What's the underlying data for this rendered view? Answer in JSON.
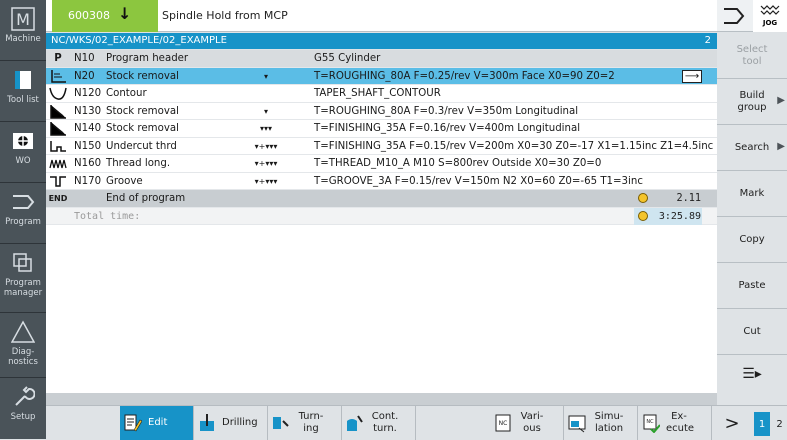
{
  "sidebar": [
    {
      "label": "Machine",
      "icon": "m-letter-icon"
    },
    {
      "label": "Tool list",
      "icon": "tool-list-icon"
    },
    {
      "label": "WO",
      "icon": "wear-offset-icon"
    },
    {
      "label": "Program",
      "icon": "program-icon"
    },
    {
      "label": "Program manager",
      "icon": "program-manager-icon"
    },
    {
      "label": "Diag-nostics",
      "icon": "diagnostics-icon"
    },
    {
      "label": "Setup",
      "icon": "wrench-icon"
    }
  ],
  "header": {
    "program_no": "600308",
    "message": "Spindle Hold from MCP",
    "mode": "JOG"
  },
  "path": {
    "text": "NC/WKS/02_EXAMPLE/02_EXAMPLE",
    "num": "2"
  },
  "rows": [
    {
      "marker": "P",
      "n": "N10",
      "name": "Program header",
      "tools": "",
      "params": "G55 Cylinder"
    },
    {
      "marker": "",
      "n": "N20",
      "name": "Stock removal",
      "tools": "▾",
      "params": "T=ROUGHING_80A F=0.25/rev V=300m Face X0=90 Z0=2"
    },
    {
      "marker": "",
      "n": "N120",
      "name": "Contour",
      "tools": "",
      "params": "TAPER_SHAFT_CONTOUR"
    },
    {
      "marker": "",
      "n": "N130",
      "name": "Stock removal",
      "tools": "▾",
      "params": "T=ROUGHING_80A F=0.3/rev V=350m Longitudinal"
    },
    {
      "marker": "",
      "n": "N140",
      "name": "Stock removal",
      "tools": "▾▾▾",
      "params": "T=FINISHING_35A F=0.16/rev V=400m Longitudinal"
    },
    {
      "marker": "",
      "n": "N150",
      "name": "Undercut thrd",
      "tools": "▾+▾▾▾",
      "params": "T=FINISHING_35A F=0.15/rev V=200m X0=30 Z0=-17 X1=1.15inc Z1=4.5inc"
    },
    {
      "marker": "",
      "n": "N160",
      "name": "Thread long.",
      "tools": "▾+▾▾▾",
      "params": "T=THREAD_M10_A M10 S=800rev Outside X0=30 Z0=0"
    },
    {
      "marker": "",
      "n": "N170",
      "name": "Groove",
      "tools": "▾+▾▾▾",
      "params": "T=GROOVE_3A F=0.15/rev V=150m N2 X0=60 Z0=-65 T1=3inc"
    }
  ],
  "end": {
    "marker": "END",
    "label": "End of program",
    "time": "2.11"
  },
  "total": {
    "label": "Total time:",
    "time": "3:25.89"
  },
  "softkeys": [
    "Select tool",
    "Build group",
    "Search",
    "Mark",
    "Copy",
    "Paste",
    "Cut"
  ],
  "bottom": {
    "edit": "Edit",
    "drilling": "Drilling",
    "turning": "Turn-ing",
    "cont": "Cont. turn.",
    "various": "Vari-ous",
    "simulation": "Simu-lation",
    "execute": "Ex-ecute",
    "page1": "1",
    "page2": "2"
  }
}
